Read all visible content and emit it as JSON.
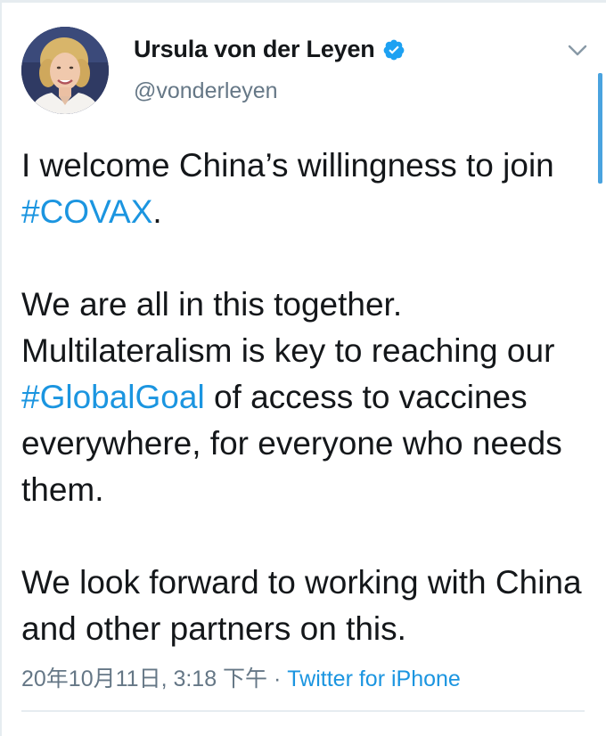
{
  "author": {
    "name": "Ursula von der Leyen",
    "handle": "@vonderleyen",
    "verified_icon": "verified-badge-icon",
    "avatar_icon": "profile-photo"
  },
  "menu_icon": "chevron-down-icon",
  "tweet": {
    "p1_a": "I welcome China’s willingness to join ",
    "p1_hashtag": "#COVAX",
    "p1_b": ".",
    "p2_a": "We are all in this together. Multilateralism is key to reaching our ",
    "p2_hashtag": "#GlobalGoal",
    "p2_b": " of access to vaccines everywhere, for everyone who needs them.",
    "p3": "We look forward to working with China and other partners on this."
  },
  "meta": {
    "timestamp": "20年10月11日, 3:18 下午",
    "separator": " · ",
    "source": "Twitter for iPhone"
  },
  "colors": {
    "link": "#1b95e0",
    "muted": "#657786",
    "text": "#14171a",
    "verified": "#1da1f2"
  }
}
